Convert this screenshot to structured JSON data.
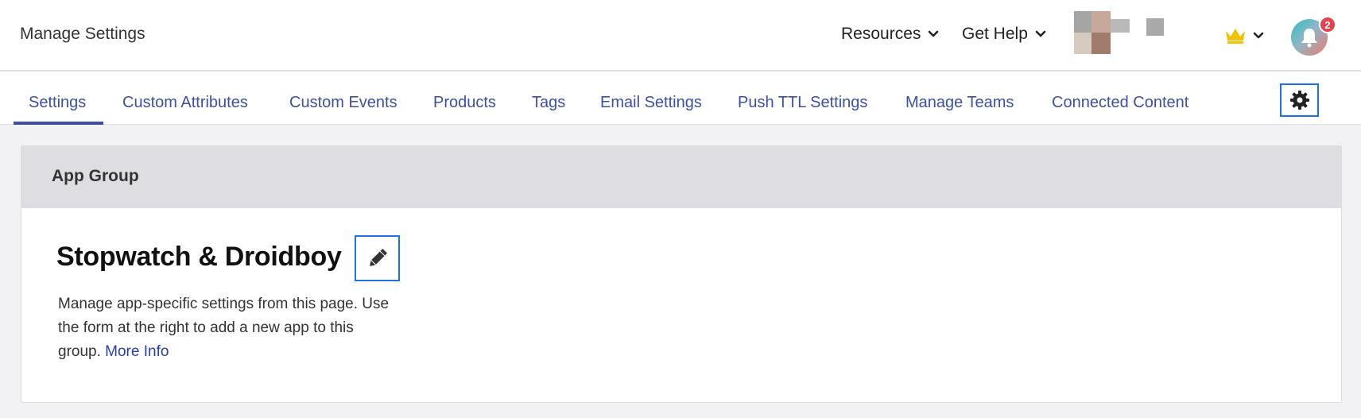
{
  "header": {
    "title": "Manage Settings",
    "menus": [
      {
        "label": "Resources",
        "icon": "chevron-down-icon"
      },
      {
        "label": "Get Help",
        "icon": "chevron-down-icon"
      }
    ],
    "crown_icon": "crown-icon",
    "notifications": {
      "icon": "bell-icon",
      "count": "2"
    }
  },
  "tabs": {
    "items": [
      {
        "label": "Settings",
        "active": true
      },
      {
        "label": "Custom Attributes"
      },
      {
        "label": "Custom Events"
      },
      {
        "label": "Products"
      },
      {
        "label": "Tags"
      },
      {
        "label": "Email Settings"
      },
      {
        "label": "Push TTL Settings"
      },
      {
        "label": "Manage Teams"
      },
      {
        "label": "Connected Content"
      }
    ],
    "settings_icon": "gear-icon"
  },
  "card": {
    "header": "App Group",
    "group_name": "Stopwatch & Droidboy",
    "edit_icon": "pencil-icon",
    "description": "Manage app-specific settings from this page. Use the form at the right to add a new app to this group. ",
    "more_info": "More Info"
  },
  "colors": {
    "accent": "#3e4fa8",
    "focus_outline": "#1a73e8",
    "badge": "#e3424f",
    "crown": "#f2c200"
  }
}
